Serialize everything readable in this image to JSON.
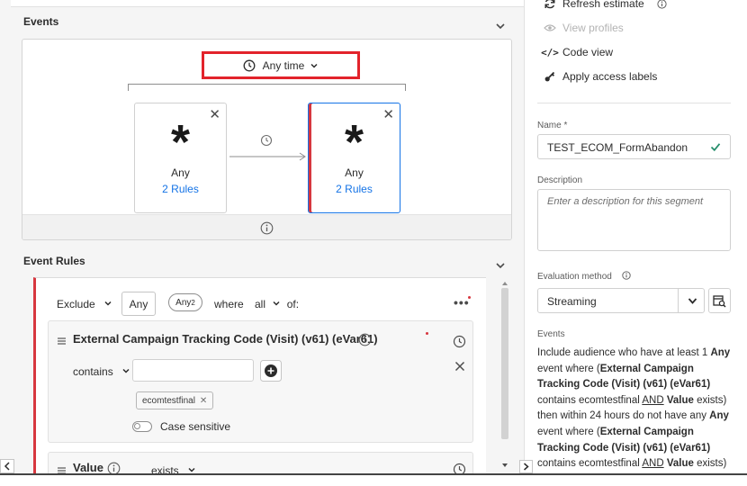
{
  "events_section": {
    "title": "Events",
    "time_filter": "Any time",
    "cards": [
      {
        "symbol": "*",
        "label": "Any",
        "rules": "2 Rules"
      },
      {
        "symbol": "*",
        "label": "Any",
        "rules": "2 Rules"
      }
    ]
  },
  "event_rules_section": {
    "title": "Event Rules",
    "exclude_label": "Exclude",
    "any_label": "Any",
    "any2_label": "Any",
    "any2_sup": "2",
    "where_label": "where",
    "all_label": "all",
    "of_label": "of:",
    "rule1": {
      "title": "External Campaign Tracking Code (Visit) (v61) (eVar61)",
      "operator": "contains",
      "value_input": "",
      "tag": "ecomtestfinal",
      "toggle_label": "Case sensitive"
    },
    "rule2": {
      "title": "Value",
      "operator": "exists"
    }
  },
  "right_panel": {
    "actions": {
      "refresh": "Refresh estimate",
      "view_profiles": "View profiles",
      "code_view": "Code view",
      "apply_labels": "Apply access labels"
    },
    "name_label": "Name *",
    "name_value": "TEST_ECOM_FormAbandon",
    "description_label": "Description",
    "description_placeholder": "Enter a description for this segment",
    "evaluation_label": "Evaluation method",
    "evaluation_value": "Streaming",
    "events_label": "Events",
    "events_description": {
      "p1": "Include audience who have at least 1 ",
      "p2": "Any",
      "p3": " event where (",
      "p4": "External Campaign Tracking Code (Visit) (v61) (eVar61)",
      "p5": " contains ecomtestfinal ",
      "p6": "AND",
      "p7": " ",
      "p8": "Value",
      "p9": " exists) then within 24 hours do not have any ",
      "p10": "Any",
      "p11": " event where (",
      "p12": "External Campaign Tracking Code (Visit) (v61) (eVar61)",
      "p13": " contains ecomtestfinal ",
      "p14": "AND",
      "p15": " ",
      "p16": "Value",
      "p17": " exists)"
    }
  },
  "colors": {
    "accent": "#1473e6",
    "highlight_red": "#e2232b",
    "valid_green": "#268e6c"
  }
}
